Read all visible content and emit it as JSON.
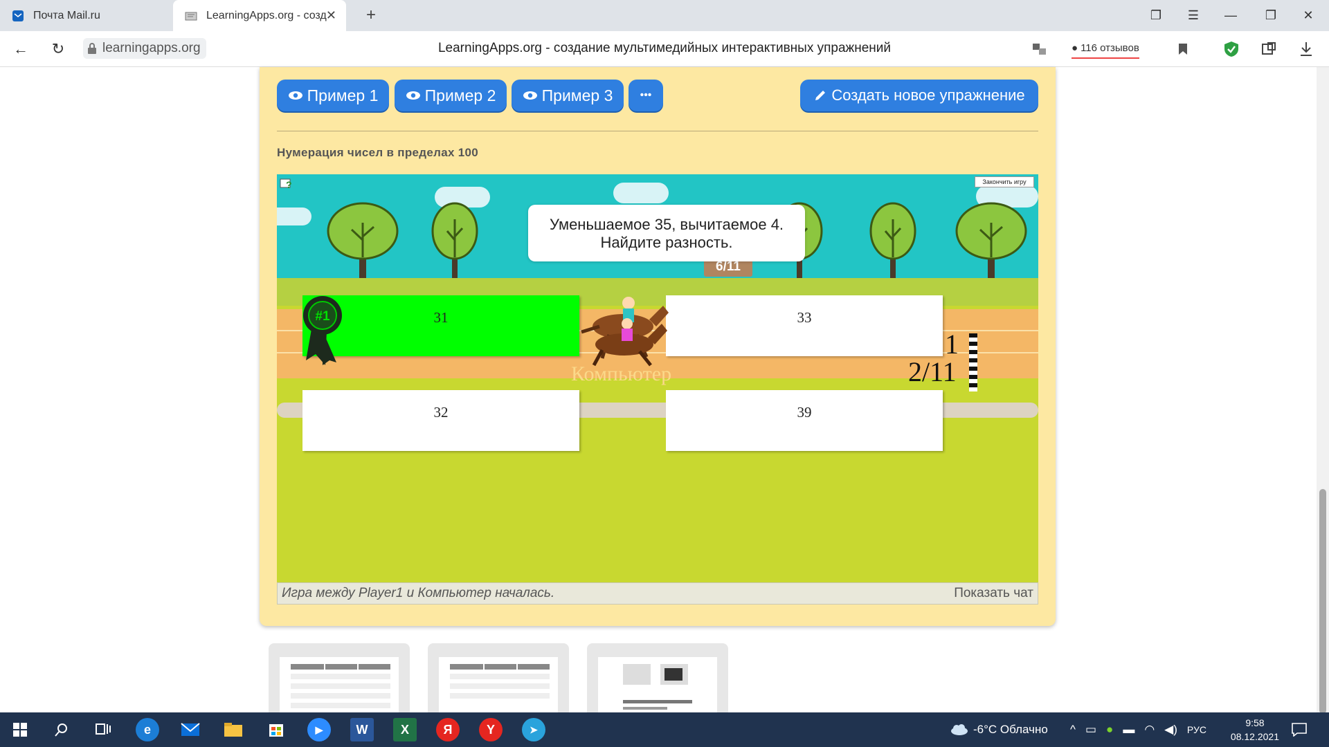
{
  "tabs": [
    {
      "title": "Почта Mail.ru"
    },
    {
      "title": "LearningApps.org - созд"
    }
  ],
  "address": {
    "url": "learningapps.org",
    "page_title": "LearningApps.org - создание мультимедийных интерактивных упражнений",
    "reviews": "116 отзывов"
  },
  "toolbar": {
    "example1": "Пример 1",
    "example2": "Пример 2",
    "example3": "Пример 3",
    "more": "•••",
    "create": "Создать новое упражнение"
  },
  "exercise": {
    "name": "Нумерация чисел в пределах 100"
  },
  "game": {
    "end_game": "Закончить игру",
    "question_line1": "Уменьшаемое 35, вычитаемое 4.",
    "question_line2": "Найдите разность.",
    "progress_sign": "6/11",
    "badge": "#1",
    "answers": [
      "31",
      "33",
      "32",
      "39"
    ],
    "player_score": "1",
    "computer_score": "2/11",
    "computer_label": "Компьютер",
    "status_message": "Игра между Player1 и Компьютер началась.",
    "show_chat": "Показать чат"
  },
  "colors": {
    "button_blue": "#2f7fe0",
    "card_bg": "#fde8a2",
    "correct_answer": "#00ff00",
    "taskbar": "#20334f"
  },
  "taskbar": {
    "weather": "-6°C  Облачно",
    "language": "РУС",
    "time": "9:58",
    "date": "08.12.2021"
  }
}
